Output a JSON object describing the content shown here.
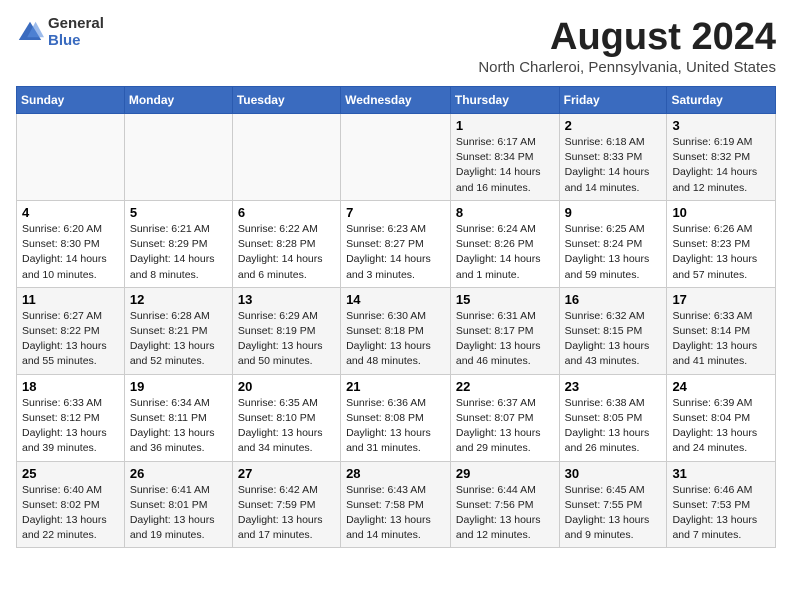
{
  "logo": {
    "general": "General",
    "blue": "Blue"
  },
  "title": "August 2024",
  "location": "North Charleroi, Pennsylvania, United States",
  "headers": [
    "Sunday",
    "Monday",
    "Tuesday",
    "Wednesday",
    "Thursday",
    "Friday",
    "Saturday"
  ],
  "weeks": [
    [
      {
        "day": "",
        "info": ""
      },
      {
        "day": "",
        "info": ""
      },
      {
        "day": "",
        "info": ""
      },
      {
        "day": "",
        "info": ""
      },
      {
        "day": "1",
        "info": "Sunrise: 6:17 AM\nSunset: 8:34 PM\nDaylight: 14 hours\nand 16 minutes."
      },
      {
        "day": "2",
        "info": "Sunrise: 6:18 AM\nSunset: 8:33 PM\nDaylight: 14 hours\nand 14 minutes."
      },
      {
        "day": "3",
        "info": "Sunrise: 6:19 AM\nSunset: 8:32 PM\nDaylight: 14 hours\nand 12 minutes."
      }
    ],
    [
      {
        "day": "4",
        "info": "Sunrise: 6:20 AM\nSunset: 8:30 PM\nDaylight: 14 hours\nand 10 minutes."
      },
      {
        "day": "5",
        "info": "Sunrise: 6:21 AM\nSunset: 8:29 PM\nDaylight: 14 hours\nand 8 minutes."
      },
      {
        "day": "6",
        "info": "Sunrise: 6:22 AM\nSunset: 8:28 PM\nDaylight: 14 hours\nand 6 minutes."
      },
      {
        "day": "7",
        "info": "Sunrise: 6:23 AM\nSunset: 8:27 PM\nDaylight: 14 hours\nand 3 minutes."
      },
      {
        "day": "8",
        "info": "Sunrise: 6:24 AM\nSunset: 8:26 PM\nDaylight: 14 hours\nand 1 minute."
      },
      {
        "day": "9",
        "info": "Sunrise: 6:25 AM\nSunset: 8:24 PM\nDaylight: 13 hours\nand 59 minutes."
      },
      {
        "day": "10",
        "info": "Sunrise: 6:26 AM\nSunset: 8:23 PM\nDaylight: 13 hours\nand 57 minutes."
      }
    ],
    [
      {
        "day": "11",
        "info": "Sunrise: 6:27 AM\nSunset: 8:22 PM\nDaylight: 13 hours\nand 55 minutes."
      },
      {
        "day": "12",
        "info": "Sunrise: 6:28 AM\nSunset: 8:21 PM\nDaylight: 13 hours\nand 52 minutes."
      },
      {
        "day": "13",
        "info": "Sunrise: 6:29 AM\nSunset: 8:19 PM\nDaylight: 13 hours\nand 50 minutes."
      },
      {
        "day": "14",
        "info": "Sunrise: 6:30 AM\nSunset: 8:18 PM\nDaylight: 13 hours\nand 48 minutes."
      },
      {
        "day": "15",
        "info": "Sunrise: 6:31 AM\nSunset: 8:17 PM\nDaylight: 13 hours\nand 46 minutes."
      },
      {
        "day": "16",
        "info": "Sunrise: 6:32 AM\nSunset: 8:15 PM\nDaylight: 13 hours\nand 43 minutes."
      },
      {
        "day": "17",
        "info": "Sunrise: 6:33 AM\nSunset: 8:14 PM\nDaylight: 13 hours\nand 41 minutes."
      }
    ],
    [
      {
        "day": "18",
        "info": "Sunrise: 6:33 AM\nSunset: 8:12 PM\nDaylight: 13 hours\nand 39 minutes."
      },
      {
        "day": "19",
        "info": "Sunrise: 6:34 AM\nSunset: 8:11 PM\nDaylight: 13 hours\nand 36 minutes."
      },
      {
        "day": "20",
        "info": "Sunrise: 6:35 AM\nSunset: 8:10 PM\nDaylight: 13 hours\nand 34 minutes."
      },
      {
        "day": "21",
        "info": "Sunrise: 6:36 AM\nSunset: 8:08 PM\nDaylight: 13 hours\nand 31 minutes."
      },
      {
        "day": "22",
        "info": "Sunrise: 6:37 AM\nSunset: 8:07 PM\nDaylight: 13 hours\nand 29 minutes."
      },
      {
        "day": "23",
        "info": "Sunrise: 6:38 AM\nSunset: 8:05 PM\nDaylight: 13 hours\nand 26 minutes."
      },
      {
        "day": "24",
        "info": "Sunrise: 6:39 AM\nSunset: 8:04 PM\nDaylight: 13 hours\nand 24 minutes."
      }
    ],
    [
      {
        "day": "25",
        "info": "Sunrise: 6:40 AM\nSunset: 8:02 PM\nDaylight: 13 hours\nand 22 minutes."
      },
      {
        "day": "26",
        "info": "Sunrise: 6:41 AM\nSunset: 8:01 PM\nDaylight: 13 hours\nand 19 minutes."
      },
      {
        "day": "27",
        "info": "Sunrise: 6:42 AM\nSunset: 7:59 PM\nDaylight: 13 hours\nand 17 minutes."
      },
      {
        "day": "28",
        "info": "Sunrise: 6:43 AM\nSunset: 7:58 PM\nDaylight: 13 hours\nand 14 minutes."
      },
      {
        "day": "29",
        "info": "Sunrise: 6:44 AM\nSunset: 7:56 PM\nDaylight: 13 hours\nand 12 minutes."
      },
      {
        "day": "30",
        "info": "Sunrise: 6:45 AM\nSunset: 7:55 PM\nDaylight: 13 hours\nand 9 minutes."
      },
      {
        "day": "31",
        "info": "Sunrise: 6:46 AM\nSunset: 7:53 PM\nDaylight: 13 hours\nand 7 minutes."
      }
    ]
  ]
}
